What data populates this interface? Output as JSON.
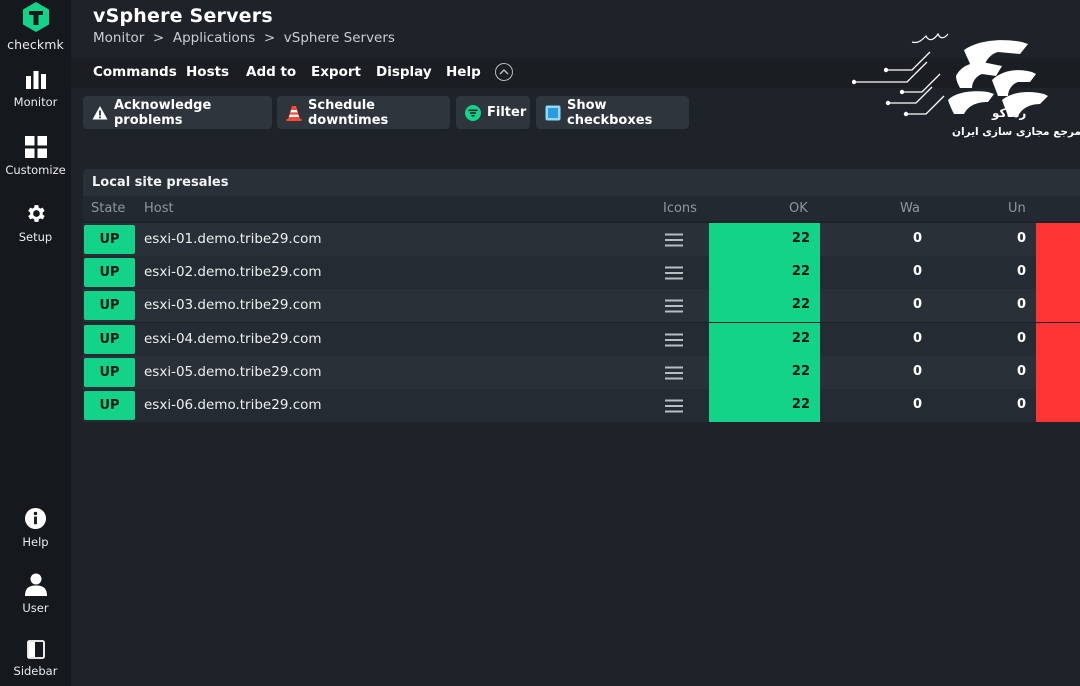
{
  "nav": {
    "logo": "checkmk",
    "items": [
      {
        "label": "Monitor",
        "icon": "monitor-icon"
      },
      {
        "label": "Customize",
        "icon": "customize-icon"
      },
      {
        "label": "Setup",
        "icon": "gear-icon"
      }
    ],
    "bottom": [
      {
        "label": "Help",
        "icon": "info-icon"
      },
      {
        "label": "User",
        "icon": "user-icon"
      },
      {
        "label": "Sidebar",
        "icon": "sidebar-icon"
      }
    ]
  },
  "header": {
    "title": "vSphere Servers",
    "breadcrumb": [
      "Monitor",
      "Applications",
      "vSphere Servers"
    ],
    "separator": ">"
  },
  "menubar": [
    "Commands",
    "Hosts",
    "Add to",
    "Export",
    "Display",
    "Help"
  ],
  "actions": [
    {
      "label": "Acknowledge problems",
      "icon": "warning-icon"
    },
    {
      "label": "Schedule downtimes",
      "icon": "cone-icon"
    },
    {
      "label": "Filter",
      "icon": "filter-icon"
    },
    {
      "label": "Show checkboxes",
      "icon": "checkbox-icon"
    }
  ],
  "table": {
    "site": "Local site presales",
    "columns": [
      "State",
      "Host",
      "Icons",
      "OK",
      "Wa",
      "Un"
    ],
    "rows": [
      {
        "state": "UP",
        "host": "esxi-01.demo.tribe29.com",
        "ok": "22",
        "warn": "0",
        "unknown": "0"
      },
      {
        "state": "UP",
        "host": "esxi-02.demo.tribe29.com",
        "ok": "22",
        "warn": "0",
        "unknown": "0"
      },
      {
        "state": "UP",
        "host": "esxi-03.demo.tribe29.com",
        "ok": "22",
        "warn": "0",
        "unknown": "0"
      },
      {
        "state": "UP",
        "host": "esxi-04.demo.tribe29.com",
        "ok": "22",
        "warn": "0",
        "unknown": "0"
      },
      {
        "state": "UP",
        "host": "esxi-05.demo.tribe29.com",
        "ok": "22",
        "warn": "0",
        "unknown": "0"
      },
      {
        "state": "UP",
        "host": "esxi-06.demo.tribe29.com",
        "ok": "22",
        "warn": "0",
        "unknown": "0"
      }
    ]
  },
  "watermark": {
    "tagline": "مرجع مجازی سازی ایران",
    "brand": "رهاکو"
  },
  "colors": {
    "ok": "#13d389",
    "crit": "#ff3434",
    "background": "#1e2329",
    "nav": "#15181c"
  }
}
